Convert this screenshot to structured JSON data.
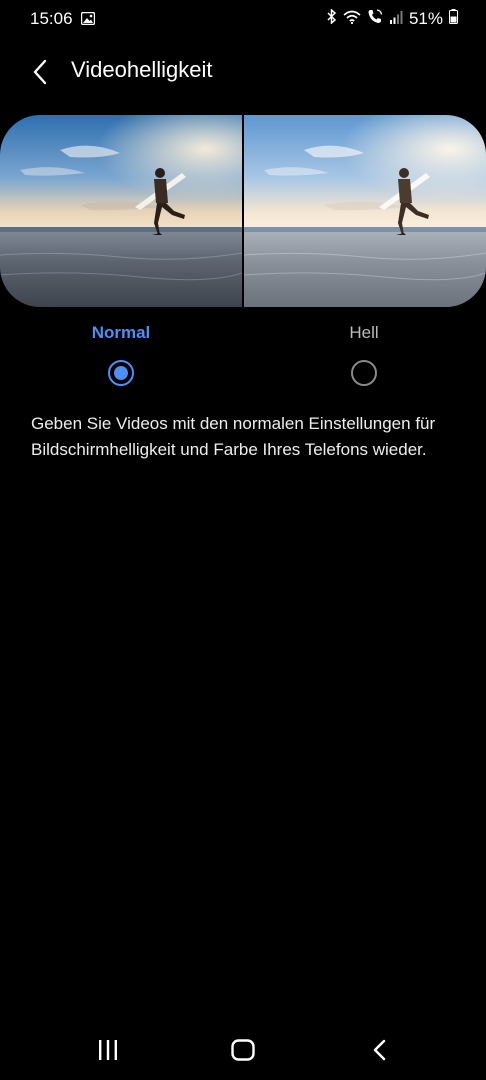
{
  "status_bar": {
    "time": "15:06",
    "battery": "51%",
    "icons": [
      "gallery-icon",
      "bluetooth-icon",
      "wifi-icon",
      "call-icon",
      "signal-icon",
      "battery-icon"
    ]
  },
  "header": {
    "title": "Videohelligkeit",
    "back_icon": "chevron-left-icon"
  },
  "preview": {
    "left_variant": "normal",
    "right_variant": "bright"
  },
  "options": [
    {
      "label": "Normal",
      "selected": true
    },
    {
      "label": "Hell",
      "selected": false
    }
  ],
  "description": "Geben Sie Videos mit den normalen Einstellungen für Bildschirmhelligkeit und Farbe Ihres Telefons wieder.",
  "nav_bar": {
    "icons": [
      "recents-icon",
      "home-icon",
      "back-icon"
    ]
  },
  "colors": {
    "accent": "#4f8ef5",
    "background": "#000000",
    "text": "#ededed",
    "inactive": "#8a8a8a"
  }
}
